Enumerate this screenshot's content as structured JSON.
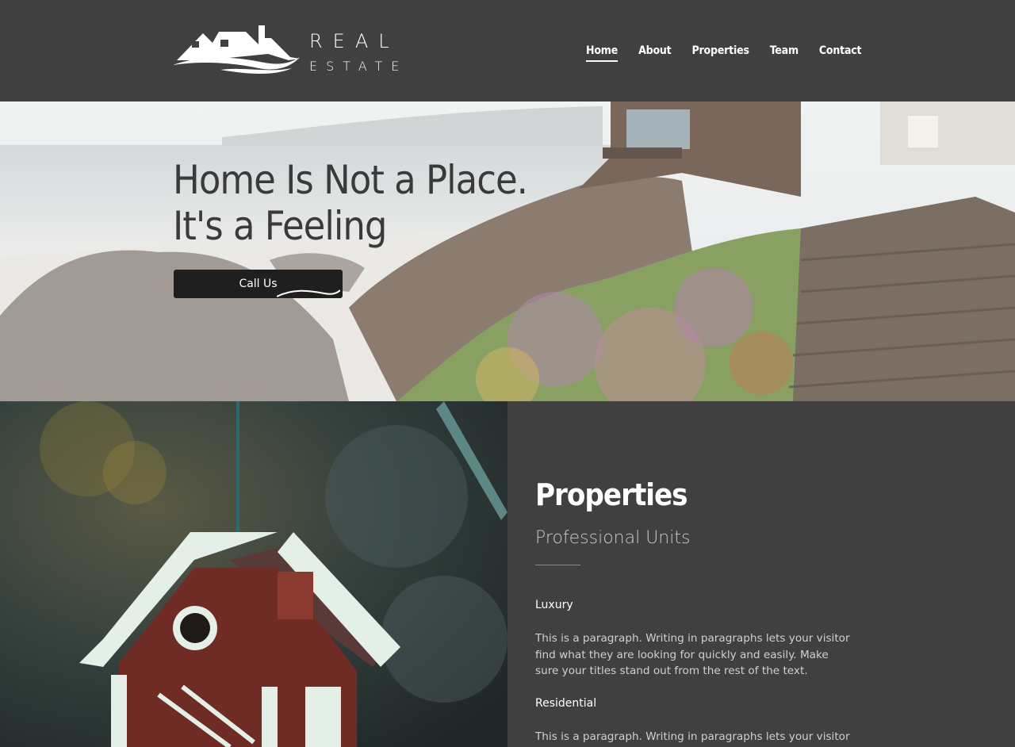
{
  "header": {
    "logo_word_1": "REAL",
    "logo_word_2": "ESTATE",
    "nav": [
      {
        "label": "Home",
        "active": true
      },
      {
        "label": "About",
        "active": false
      },
      {
        "label": "Properties",
        "active": false
      },
      {
        "label": "Team",
        "active": false
      },
      {
        "label": "Contact",
        "active": false
      }
    ]
  },
  "hero": {
    "title_line_1": "Home Is Not a Place.",
    "title_line_2": "It's a Feeling",
    "cta_label": "Call Us"
  },
  "properties": {
    "title": "Properties",
    "subtitle": "Professional Units",
    "items": [
      {
        "heading": "Luxury",
        "text": "This is a paragraph. Writing in paragraphs lets your visitor find what they are looking for quickly and easily. Make sure your titles stand out from the rest of the text."
      },
      {
        "heading": "Residential",
        "text": "This is a paragraph. Writing in paragraphs lets your visitor find"
      }
    ]
  },
  "colors": {
    "header_bg": "#404040",
    "button_bg": "#1f1f1f",
    "text": "#ffffff"
  }
}
